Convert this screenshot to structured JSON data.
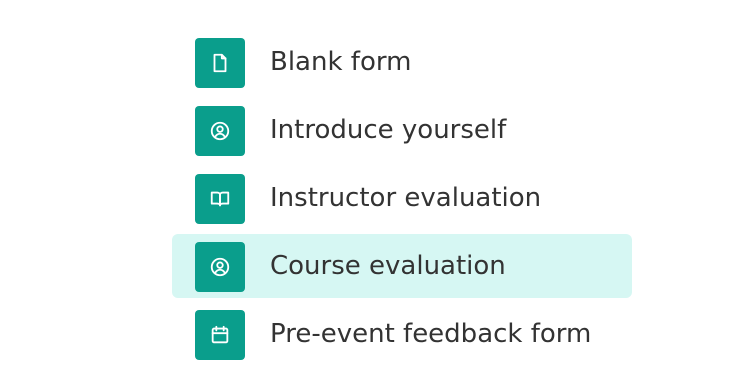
{
  "colors": {
    "icon_tile": "#0a9e8c",
    "selected_bg": "#d6f7f3",
    "label_text": "#333333"
  },
  "templates": [
    {
      "label": "Blank form",
      "icon": "document-icon",
      "selected": false
    },
    {
      "label": "Introduce yourself",
      "icon": "user-circle-icon",
      "selected": false
    },
    {
      "label": "Instructor evaluation",
      "icon": "book-icon",
      "selected": false
    },
    {
      "label": "Course evaluation",
      "icon": "user-circle-icon",
      "selected": true
    },
    {
      "label": "Pre-event feedback form",
      "icon": "calendar-icon",
      "selected": false
    }
  ]
}
